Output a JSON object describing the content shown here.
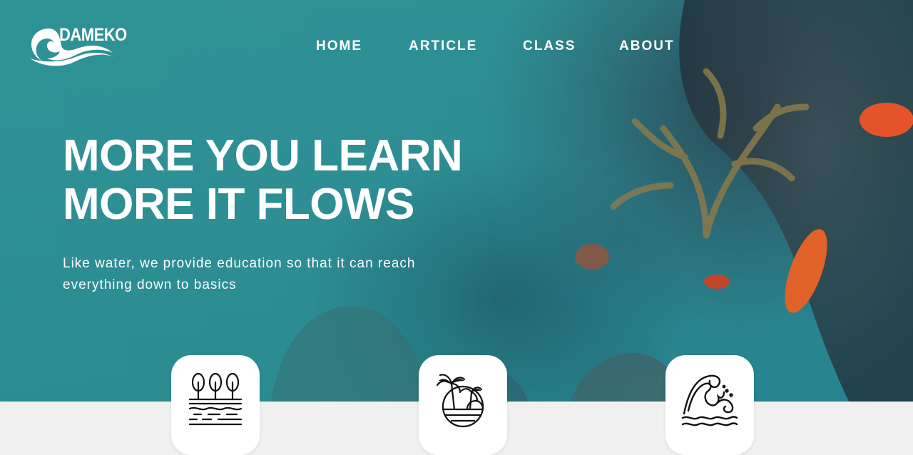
{
  "brand": {
    "name": "DAMEKO",
    "logo_icon": "wave-icon"
  },
  "nav": {
    "items": [
      {
        "label": "HOME"
      },
      {
        "label": "ARTICLE"
      },
      {
        "label": "CLASS"
      },
      {
        "label": "ABOUT"
      }
    ]
  },
  "hero": {
    "headline_line1": "MORE YOU LEARN",
    "headline_line2": "MORE IT FLOWS",
    "subtext_line1": "Like water, we provide education so that it can reach",
    "subtext_line2": "everything down to basics",
    "background_image": "underwater-diver-coral-reef-photo"
  },
  "cards": [
    {
      "icon": "trees-land-icon"
    },
    {
      "icon": "palm-island-icon"
    },
    {
      "icon": "ocean-waves-icon"
    }
  ],
  "colors": {
    "hero_teal": "#2f8e93",
    "text": "#ffffff",
    "card_bg": "#ffffff",
    "page_bg": "#f0f0f0",
    "icon_stroke": "#111111"
  }
}
